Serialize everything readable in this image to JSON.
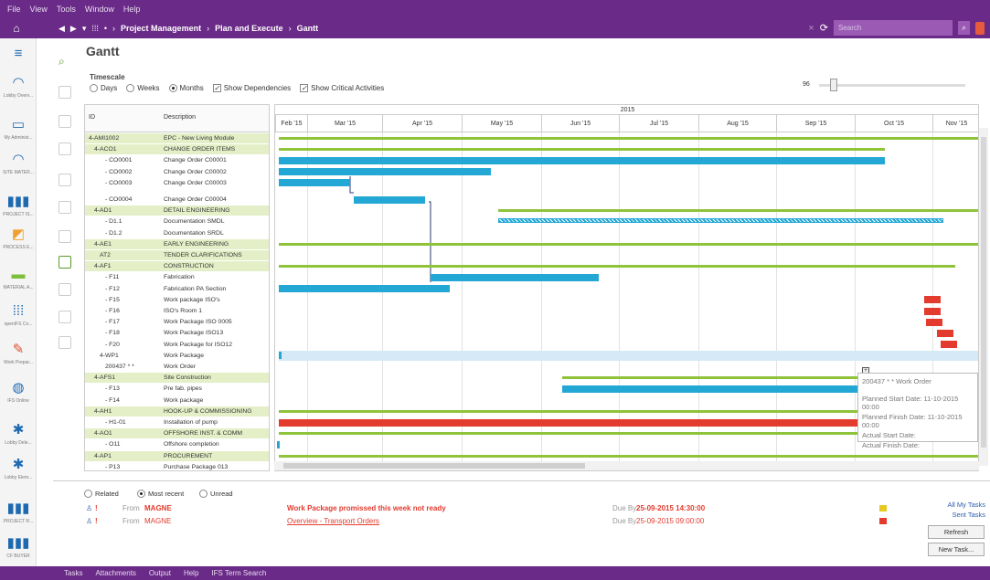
{
  "menu": [
    "File",
    "View",
    "Tools",
    "Window",
    "Help"
  ],
  "nav": {
    "crumb1": "Project Management",
    "crumb2": "Plan and Execute",
    "crumb3": "Gantt",
    "search_placeholder": "Search"
  },
  "leftnav": [
    {
      "label": "Lobby Overv...",
      "icon": "gauge-icon",
      "color": "#1e6ab0"
    },
    {
      "label": "My Administ...",
      "icon": "monitor-icon",
      "color": "#1e6ab0"
    },
    {
      "label": "SITE MATER...",
      "icon": "gauge-icon",
      "color": "#1e6ab0"
    },
    {
      "label": "PROJECT IS...",
      "icon": "bar-chart-icon",
      "color": "#1e6ab0"
    },
    {
      "label": "PROCESS E...",
      "icon": "chart-icon",
      "color": "#f0a030"
    },
    {
      "label": "MATERIAL A...",
      "icon": "pallet-icon",
      "color": "#7bbf3a"
    },
    {
      "label": "openIFS Co...",
      "icon": "people-icon",
      "color": "#1e6ab0"
    },
    {
      "label": "Work Prepar...",
      "icon": "wrench-icon",
      "color": "#e05030"
    },
    {
      "label": "IFS Online",
      "icon": "globe-icon",
      "color": "#1e6ab0"
    },
    {
      "label": "Lobby Dele...",
      "icon": "puzzle-icon",
      "color": "#1e6ab0"
    },
    {
      "label": "Lobby Elem...",
      "icon": "puzzle-icon",
      "color": "#1e6ab0"
    },
    {
      "label": "PROJECT R...",
      "icon": "bar-chart-icon",
      "color": "#1e6ab0"
    },
    {
      "label": "CF BUYER",
      "icon": "bar-chart-icon",
      "color": "#1e6ab0"
    }
  ],
  "page": {
    "title": "Gantt"
  },
  "timescale": {
    "label": "Timescale",
    "days": "Days",
    "weeks": "Weeks",
    "months": "Months",
    "show_dependencies": "Show Dependencies",
    "show_critical": "Show Critical Activities",
    "zoom": "96"
  },
  "grid": {
    "col_id": "ID",
    "col_desc": "Description"
  },
  "rows": [
    {
      "id": "4-AMI1002",
      "desc": "EPC - New Living Module",
      "group": true
    },
    {
      "id": "4-ACO1",
      "desc": "CHANGE ORDER ITEMS",
      "group": true
    },
    {
      "id": "- CO0001",
      "desc": "Change Order C00001",
      "group": false
    },
    {
      "id": "- CO0002",
      "desc": "Change Order C00002",
      "group": false
    },
    {
      "id": "- CO0003",
      "desc": "Change Order C00003",
      "group": false
    },
    {
      "id": "- CO0004",
      "desc": "Change Order C00004",
      "group": false
    },
    {
      "id": "4-AD1",
      "desc": "DETAIL ENGINEERING",
      "group": true
    },
    {
      "id": "- D1.1",
      "desc": "Documentation SMDL",
      "group": false
    },
    {
      "id": "- D1.2",
      "desc": "Documentation SRDL",
      "group": false
    },
    {
      "id": "4-AE1",
      "desc": "EARLY ENGINEERING",
      "group": true
    },
    {
      "id": "AT2",
      "desc": "TENDER CLARIFICATIONS",
      "group": true
    },
    {
      "id": "4-AF1",
      "desc": "CONSTRUCTION",
      "group": true
    },
    {
      "id": "- F11",
      "desc": "Fabrication",
      "group": false
    },
    {
      "id": "- F12",
      "desc": "Fabrication PA Section",
      "group": false
    },
    {
      "id": "- F15",
      "desc": "Work package ISO's",
      "group": false
    },
    {
      "id": "- F16",
      "desc": "ISO's Room 1",
      "group": false
    },
    {
      "id": "- F17",
      "desc": "Work Package ISO 0005",
      "group": false
    },
    {
      "id": "- F18",
      "desc": "Work Package ISO13",
      "group": false
    },
    {
      "id": "- F20",
      "desc": "Work Package for ISO12",
      "group": false
    },
    {
      "id": "4-WP1",
      "desc": "Work Package",
      "group": false
    },
    {
      "id": "200437 * *",
      "desc": "Work Order",
      "group": false
    },
    {
      "id": "4-AFS1",
      "desc": "Site Construction",
      "group": true
    },
    {
      "id": "- F13",
      "desc": "Pre fab. pipes",
      "group": false
    },
    {
      "id": "- F14",
      "desc": "Work package",
      "group": false
    },
    {
      "id": "4-AH1",
      "desc": "HOOK-UP & COMMISSIONING",
      "group": true
    },
    {
      "id": "- H1-01",
      "desc": "Installation of pump",
      "group": false
    },
    {
      "id": "4-AO1",
      "desc": "OFFSHORE INST. & COMM",
      "group": true
    },
    {
      "id": "- O11",
      "desc": "Offshore completion",
      "group": false
    },
    {
      "id": "4-AP1",
      "desc": "PROCUREMENT",
      "group": true
    },
    {
      "id": "- P13",
      "desc": "Purchase Package 013",
      "group": false
    }
  ],
  "chart": {
    "year": "2015",
    "months": [
      "Feb '15",
      "Mar '15",
      "Apr '15",
      "May '15",
      "Jun '15",
      "Jul '15",
      "Aug '15",
      "Sep '15",
      "Oct '15",
      "Nov '15"
    ],
    "tooltip": {
      "title": "200437 * * Work Order",
      "planned_start": "Planned Start Date: 11-10-2015 00:00",
      "planned_finish": "Planned Finish Date: 11-10-2015 00:00",
      "actual_start": "Actual Start Date:",
      "actual_finish": "Actual Finish Date:"
    }
  },
  "tasks_filter": {
    "related": "Related",
    "most_recent": "Most recent",
    "unread": "Unread"
  },
  "tasks": [
    {
      "from": "From",
      "sender": "MAGNE",
      "subject": "Work Package promissed this week not ready",
      "due_label": "Due By",
      "due": "25-09-2015 14:30:00"
    },
    {
      "from": "From",
      "sender": "MAGNE",
      "subject": "Overview - Transport Orders",
      "due_label": "Due By",
      "due": "25-09-2015 09:00:00"
    }
  ],
  "task_links": {
    "all": "All My Tasks",
    "sent": "Sent Tasks",
    "refresh": "Refresh",
    "new": "New Task..."
  },
  "bottombar": [
    "Tasks",
    "Attachments",
    "Output",
    "Help",
    "IFS Term Search"
  ],
  "colors": {
    "purple": "#6a2a87",
    "bar_blue": "#23a8d6",
    "bar_green": "#8fc33a",
    "bar_red": "#e33b2e",
    "group_row": "#e4efc7"
  }
}
